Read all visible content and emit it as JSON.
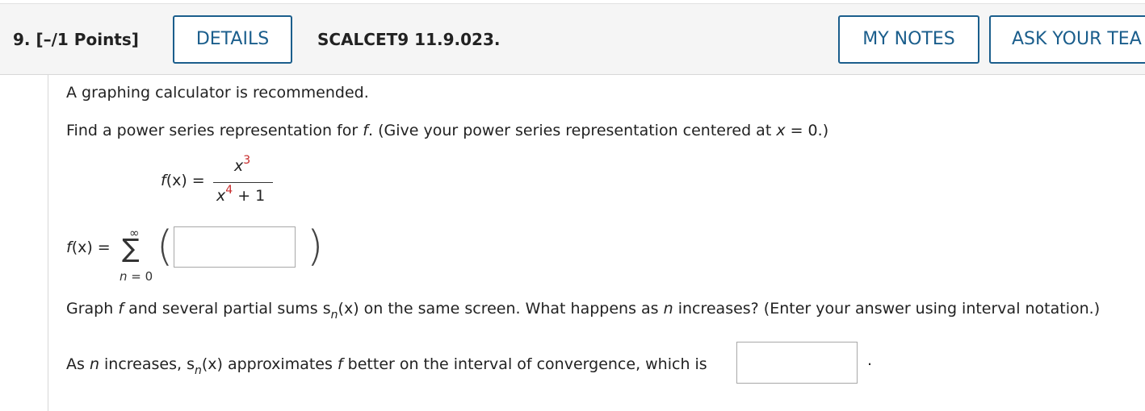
{
  "header": {
    "question_number": "9.",
    "points": "[–/1 Points]",
    "details_label": "DETAILS",
    "problem_code": "SCALCET9 11.9.023.",
    "my_notes_label": "MY NOTES",
    "ask_teacher_label": "ASK YOUR TEA"
  },
  "body": {
    "calculator_note": "A graphing calculator is recommended.",
    "instruction": {
      "part1": "Find a power series representation for ",
      "f": "f",
      "part2": ". (Give your power series representation centered at ",
      "x": "x",
      "part3": " = 0.)"
    },
    "function": {
      "lhs_f": "f",
      "lhs_rest": "(x) =",
      "numerator_base": "x",
      "numerator_exp": "3",
      "denominator_base": "x",
      "denominator_exp": "4",
      "denominator_rest": " + 1"
    },
    "series": {
      "lhs_f": "f",
      "lhs_rest": "(x) =",
      "upper_limit": "∞",
      "sigma": "∑",
      "index_var": "n",
      "index_rest": " = 0",
      "left_paren": "(",
      "right_paren": ")",
      "answer_value": ""
    },
    "graph_question": {
      "part1": "Graph ",
      "f": "f",
      "part2": " and several partial sums s",
      "sub_n": "n",
      "part3": "(x) on the same screen. What happens as ",
      "n": "n",
      "part4": " increases? (Enter your answer using interval notation.)"
    },
    "convergence": {
      "part1": "As ",
      "n": "n",
      "part2": " increases, s",
      "sub_n": "n",
      "part3": "(x) approximates ",
      "f": "f",
      "part4": " better on the interval of convergence, which is",
      "answer_value": "",
      "period": "."
    }
  }
}
